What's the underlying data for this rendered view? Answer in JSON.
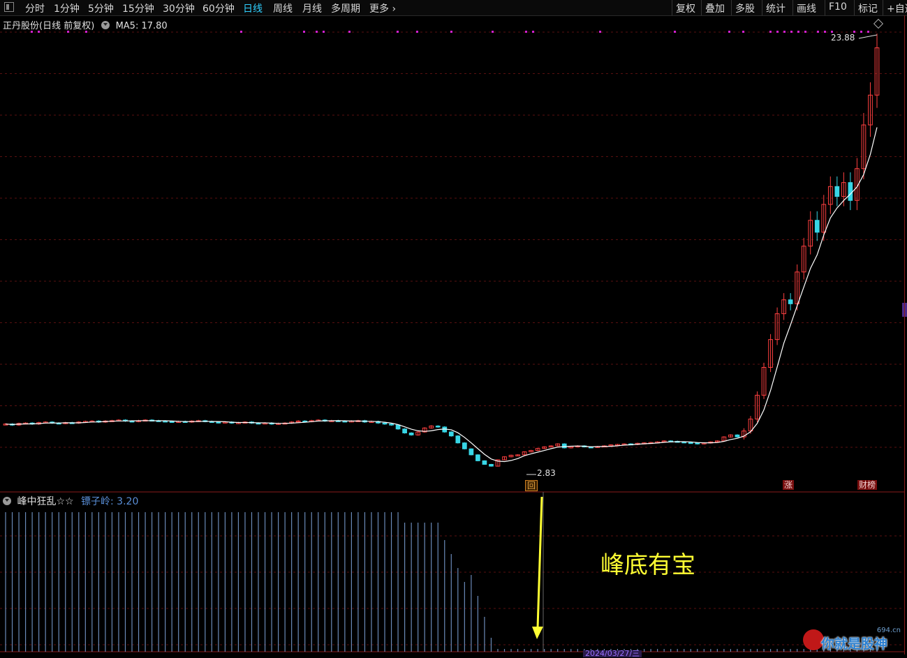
{
  "toolbar": {
    "periods": [
      "分时",
      "1分钟",
      "5分钟",
      "15分钟",
      "30分钟",
      "60分钟",
      "日线",
      "周线",
      "月线",
      "多周期",
      "更多"
    ],
    "active_period": "日线",
    "tools": [
      "复权",
      "叠加",
      "多股",
      "统计",
      "画线",
      "F10",
      "标记",
      "+自选"
    ]
  },
  "stock": {
    "name_label": "正丹股份(日线 前复权)",
    "ma_label": "MA5: 17.80"
  },
  "indicator": {
    "name": "峰中狂乱☆☆",
    "value_label": "镖子岭: 3.20"
  },
  "annotation": "峰底有宝",
  "markers": {
    "high_label": "23.88",
    "low_label": "2.83",
    "zhang": "涨",
    "cai": "财榜",
    "huidi": "回"
  },
  "date_label": "2024/03/27/三",
  "watermark": {
    "site": "694.cn",
    "text": "你就是股神"
  },
  "colors": {
    "up": "#ff4040",
    "down": "#38d6e6",
    "ma": "#ffffff",
    "grid": "#5a1010",
    "indicator_bar": "#6a8ab8",
    "arrow": "#ffff33",
    "top_dots": "#d020d0"
  },
  "chart_data": {
    "type": "candlestick",
    "ylim": [
      2.2,
      24.6
    ],
    "high": 23.88,
    "low": 2.83,
    "ma5_last": 17.8,
    "closes": [
      4.95,
      4.9,
      4.98,
      5.0,
      4.95,
      5.02,
      5.05,
      5.0,
      4.98,
      5.02,
      5.0,
      5.05,
      5.08,
      5.1,
      5.05,
      5.1,
      5.12,
      5.15,
      5.1,
      5.08,
      5.12,
      5.15,
      5.12,
      5.1,
      5.08,
      5.05,
      5.08,
      5.05,
      5.1,
      5.12,
      5.08,
      5.05,
      5.02,
      5.05,
      5.0,
      5.02,
      5.05,
      5.0,
      4.98,
      5.0,
      4.95,
      4.98,
      5.0,
      5.05,
      5.1,
      5.08,
      5.12,
      5.15,
      5.1,
      5.12,
      5.1,
      5.08,
      5.1,
      5.12,
      5.05,
      5.08,
      5.0,
      4.95,
      4.9,
      4.7,
      4.5,
      4.4,
      4.55,
      4.75,
      4.85,
      4.8,
      4.55,
      4.35,
      4.0,
      3.7,
      3.4,
      3.1,
      2.92,
      2.83,
      3.15,
      3.3,
      3.38,
      3.4,
      3.55,
      3.62,
      3.72,
      3.8,
      3.85,
      3.95,
      3.75,
      3.82,
      3.85,
      3.8,
      3.78,
      3.82,
      3.85,
      3.9,
      3.92,
      3.95,
      3.92,
      3.98,
      4.0,
      4.02,
      4.05,
      4.1,
      4.08,
      4.05,
      4.02,
      4.0,
      3.95,
      4.0,
      4.05,
      4.1,
      4.3,
      4.4,
      4.3,
      4.6,
      5.2,
      6.4,
      7.8,
      9.2,
      10.5,
      11.2,
      11.0,
      12.6,
      13.9,
      15.2,
      14.6,
      16.0,
      16.9,
      16.4,
      17.1,
      16.2,
      17.8,
      20.0,
      21.5,
      23.88
    ],
    "bars_note": "indicator column heights (relative 0-1)"
  }
}
